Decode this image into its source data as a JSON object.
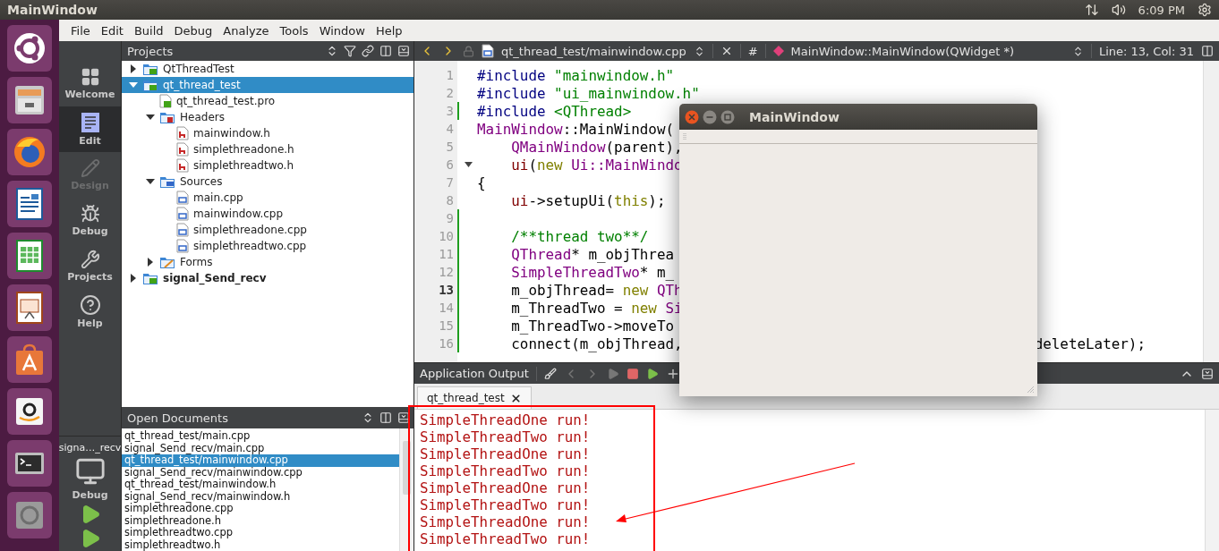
{
  "top_bar": {
    "title": "MainWindow",
    "clock": "6:09 PM"
  },
  "launcher": [
    {
      "kind": "dash"
    },
    {
      "kind": "files"
    },
    {
      "kind": "browser"
    },
    {
      "kind": "writer"
    },
    {
      "kind": "calc"
    },
    {
      "kind": "impress"
    },
    {
      "kind": "software"
    },
    {
      "kind": "amazon"
    },
    {
      "kind": "terminal"
    },
    {
      "kind": "help"
    }
  ],
  "menu": [
    "File",
    "Edit",
    "Build",
    "Debug",
    "Analyze",
    "Tools",
    "Window",
    "Help"
  ],
  "modes": [
    {
      "label": "Welcome",
      "kind": "welcome",
      "selected": false,
      "disabled": false
    },
    {
      "label": "Edit",
      "kind": "edit",
      "selected": true,
      "disabled": false
    },
    {
      "label": "Design",
      "kind": "design",
      "selected": false,
      "disabled": true
    },
    {
      "label": "Debug",
      "kind": "debug",
      "selected": false,
      "disabled": false
    },
    {
      "label": "Projects",
      "kind": "projects",
      "selected": false,
      "disabled": false
    },
    {
      "label": "Help",
      "kind": "help",
      "selected": false,
      "disabled": false
    }
  ],
  "kit": {
    "project": "signa…_recv",
    "build": "Debug"
  },
  "projects": {
    "title": "Projects",
    "tree": [
      {
        "label": "QtThreadTest",
        "kind": "project",
        "selected": false,
        "expanded": false,
        "active": false
      },
      {
        "label": "qt_thread_test",
        "kind": "project",
        "selected": true,
        "expanded": true,
        "active": false,
        "children": [
          {
            "label": "qt_thread_test.pro",
            "kind": "pro",
            "selected": false
          },
          {
            "label": "Headers",
            "kind": "headers",
            "selected": false,
            "expanded": true,
            "children": [
              {
                "label": "mainwindow.h",
                "kind": "h",
                "selected": false
              },
              {
                "label": "simplethreadone.h",
                "kind": "h",
                "selected": false
              },
              {
                "label": "simplethreadtwo.h",
                "kind": "h",
                "selected": false
              }
            ]
          },
          {
            "label": "Sources",
            "kind": "sources",
            "selected": false,
            "expanded": true,
            "children": [
              {
                "label": "main.cpp",
                "kind": "cpp",
                "selected": false
              },
              {
                "label": "mainwindow.cpp",
                "kind": "cpp",
                "selected": false
              },
              {
                "label": "simplethreadone.cpp",
                "kind": "cpp",
                "selected": false
              },
              {
                "label": "simplethreadtwo.cpp",
                "kind": "cpp",
                "selected": false
              }
            ]
          },
          {
            "label": "Forms",
            "kind": "forms",
            "selected": false,
            "expanded": false
          }
        ]
      },
      {
        "label": "signal_Send_recv",
        "kind": "project",
        "selected": false,
        "expanded": false,
        "active": true
      }
    ]
  },
  "open_documents": {
    "title": "Open Documents",
    "items": [
      {
        "label": "qt_thread_test/main.cpp",
        "selected": false
      },
      {
        "label": "signal_Send_recv/main.cpp",
        "selected": false
      },
      {
        "label": "qt_thread_test/mainwindow.cpp",
        "selected": true
      },
      {
        "label": "signal_Send_recv/mainwindow.cpp",
        "selected": false
      },
      {
        "label": "qt_thread_test/mainwindow.h",
        "selected": false
      },
      {
        "label": "signal_Send_recv/mainwindow.h",
        "selected": false
      },
      {
        "label": "simplethreadone.cpp",
        "selected": false
      },
      {
        "label": "simplethreadone.h",
        "selected": false
      },
      {
        "label": "simplethreadtwo.cpp",
        "selected": false
      },
      {
        "label": "simplethreadtwo.h",
        "selected": false
      }
    ]
  },
  "editor": {
    "file": "qt_thread_test/mainwindow.cpp",
    "hash": "#",
    "symbol": "MainWindow::MainWindow(QWidget *)",
    "position": "Line: 13, Col: 31",
    "lines": [
      {
        "number": "1",
        "current": false,
        "changed": false,
        "fold": false,
        "segments": [
          {
            "kind": "preproc",
            "text": "#include "
          },
          {
            "kind": "string",
            "text": "\"mainwindow.h\""
          }
        ]
      },
      {
        "number": "2",
        "current": false,
        "changed": false,
        "fold": false,
        "segments": [
          {
            "kind": "preproc",
            "text": "#include "
          },
          {
            "kind": "string",
            "text": "\"ui_mainwindow.h\""
          }
        ]
      },
      {
        "number": "3",
        "current": false,
        "changed": true,
        "fold": false,
        "segments": [
          {
            "kind": "preproc",
            "text": "#include "
          },
          {
            "kind": "string",
            "text": "<QThread>"
          }
        ]
      },
      {
        "number": "4",
        "current": false,
        "changed": false,
        "fold": false,
        "segments": [
          {
            "kind": "type",
            "text": "MainWindow"
          },
          {
            "kind": "plain",
            "text": "::MainWindow("
          }
        ]
      },
      {
        "number": "5",
        "current": false,
        "changed": false,
        "fold": false,
        "segments": [
          {
            "kind": "type",
            "text": "    QMainWindow"
          },
          {
            "kind": "plain",
            "text": "(parent),"
          }
        ]
      },
      {
        "number": "6",
        "current": false,
        "changed": false,
        "fold": true,
        "segments": [
          {
            "kind": "member",
            "text": "    ui"
          },
          {
            "kind": "plain",
            "text": "("
          },
          {
            "kind": "keyword",
            "text": "new"
          },
          {
            "kind": "type",
            "text": " Ui::MainWindo"
          }
        ]
      },
      {
        "number": "7",
        "current": false,
        "changed": false,
        "fold": false,
        "segments": [
          {
            "kind": "plain",
            "text": "{"
          }
        ]
      },
      {
        "number": "8",
        "current": false,
        "changed": false,
        "fold": false,
        "segments": [
          {
            "kind": "member",
            "text": "    ui"
          },
          {
            "kind": "plain",
            "text": "->setupUi("
          },
          {
            "kind": "keyword",
            "text": "this"
          },
          {
            "kind": "plain",
            "text": ");"
          }
        ]
      },
      {
        "number": "9",
        "current": false,
        "changed": true,
        "fold": false
      },
      {
        "number": "10",
        "current": false,
        "changed": true,
        "fold": false,
        "segments": [
          {
            "kind": "comment",
            "text": "    /**thread two**/"
          }
        ]
      },
      {
        "number": "11",
        "current": false,
        "changed": true,
        "fold": false,
        "segments": [
          {
            "kind": "type",
            "text": "    QThread"
          },
          {
            "kind": "plain",
            "text": "* m_objThrea"
          }
        ]
      },
      {
        "number": "12",
        "current": false,
        "changed": true,
        "fold": false,
        "segments": [
          {
            "kind": "type",
            "text": "    SimpleThreadTwo"
          },
          {
            "kind": "plain",
            "text": "* m_"
          }
        ]
      },
      {
        "number": "13",
        "current": true,
        "changed": true,
        "fold": false,
        "segments": [
          {
            "kind": "plain",
            "text": "    m_objThread= "
          },
          {
            "kind": "keyword",
            "text": "new"
          },
          {
            "kind": "type",
            "text": " QTh"
          }
        ]
      },
      {
        "number": "14",
        "current": false,
        "changed": true,
        "fold": false,
        "segments": [
          {
            "kind": "plain",
            "text": "    m_ThreadTwo = "
          },
          {
            "kind": "keyword",
            "text": "new"
          },
          {
            "kind": "type",
            "text": " Si"
          }
        ]
      },
      {
        "number": "15",
        "current": false,
        "changed": true,
        "fold": false,
        "segments": [
          {
            "kind": "plain",
            "text": "    m_ThreadTwo->moveTo"
          }
        ]
      },
      {
        "number": "16",
        "current": false,
        "changed": true,
        "fold": false,
        "segments": [
          {
            "kind": "plain",
            "text": "    connect(m_objThread,"
          }
        ],
        "right": [
          {
            "kind": "plain",
            "text": "deleteLater);"
          }
        ]
      }
    ]
  },
  "output": {
    "title": "Application Output",
    "tab": "qt_thread_test",
    "lines": [
      "SimpleThreadOne run!",
      "SimpleThreadTwo run!",
      "SimpleThreadOne run!",
      "SimpleThreadTwo run!",
      "SimpleThreadOne run!",
      "SimpleThreadTwo run!",
      "SimpleThreadOne run!",
      "SimpleThreadTwo run!"
    ]
  },
  "floating_window": {
    "title": "MainWindow"
  }
}
